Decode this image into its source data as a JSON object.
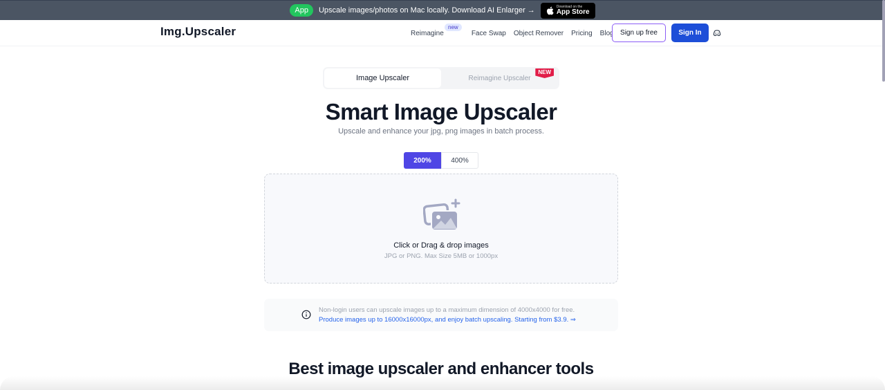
{
  "banner": {
    "app_badge": "App",
    "text": "Upscale images/photos on Mac locally. Download AI Enlarger →",
    "appstore_small": "Download on the",
    "appstore_big": "App Store"
  },
  "navbar": {
    "logo": "Img.Upscaler",
    "links": [
      {
        "label": "Reimagine",
        "badge": "new"
      },
      {
        "label": "Face Swap"
      },
      {
        "label": "Object Remover"
      },
      {
        "label": "Pricing"
      },
      {
        "label": "Blog"
      }
    ],
    "signup_label": "Sign up free",
    "signin_label": "Sign In"
  },
  "tabs": [
    {
      "label": "Image Upscaler",
      "active": true
    },
    {
      "label": "Reimagine Upscaler",
      "active": false,
      "flag": "NEW"
    }
  ],
  "hero": {
    "title": "Smart Image Upscaler",
    "subtitle": "Upscale and enhance your jpg, png images in batch process."
  },
  "scale_options": [
    {
      "label": "200%",
      "selected": true
    },
    {
      "label": "400%",
      "selected": false
    }
  ],
  "dropzone": {
    "main_text": "Click or Drag & drop images",
    "sub_text": "JPG or PNG. Max Size 5MB or 1000px"
  },
  "notice": {
    "line1": "Non-login users can upscale images up to a maximum dimension of 4000x4000 for free.",
    "line2": "Produce images up to 16000x16000px, and enjoy batch upscaling. Starting from $3.9. ⇒"
  },
  "section": {
    "title": "Best image upscaler and enhancer tools"
  },
  "colors": {
    "banner_bg": "#4b5563",
    "app_badge": "#22c55e",
    "primary": "#1d4ed8",
    "scale_active": "#4f46e5",
    "new_flag": "#e11d48",
    "link_blue": "#2563eb"
  }
}
